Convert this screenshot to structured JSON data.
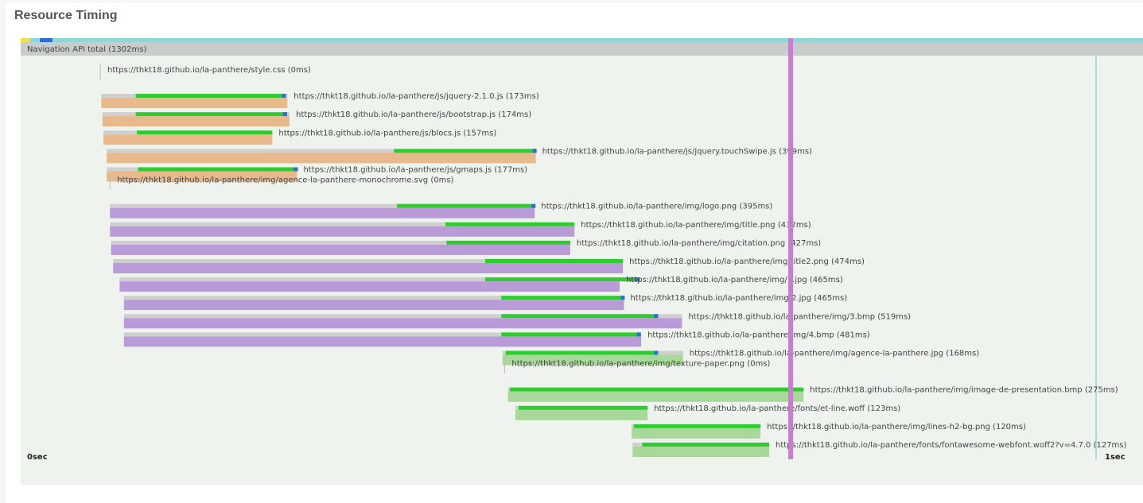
{
  "page": {
    "title": "Resource Timing"
  },
  "chart_data": {
    "type": "bar",
    "title": "Resource Timing",
    "time_unit": "ms",
    "xlim": [
      0,
      1000
    ],
    "x_ticks": [
      "0sec",
      "1sec"
    ],
    "navigation_total": {
      "label": "Navigation API total (1302ms)",
      "duration_ms": 1302
    },
    "colors": {
      "css": "#e8b98a",
      "js": "#e8b98a",
      "img": "#b99bd8",
      "other": "#a8d89a",
      "response": "#2ecc2e",
      "dns_connect": "#2a6fd6",
      "wait": "#cfcfcf",
      "marker": "#cc7ad6",
      "axis_line": "#8fd6d6",
      "lane": "#eef3ee"
    },
    "marker_ms": 716,
    "resources": [
      {
        "url": "https://thkt18.github.io/la-panthere/style.css (0ms)",
        "kind": "css",
        "start": 74,
        "duration": 0,
        "resp_start": 74,
        "resp_end": 74,
        "blue": false
      },
      {
        "url": "https://thkt18.github.io/la-panthere/js/jquery-2.1.0.js (173ms)",
        "kind": "js",
        "start": 75,
        "duration": 173,
        "resp_start": 107,
        "resp_end": 246,
        "blue": true
      },
      {
        "url": "https://thkt18.github.io/la-panthere/js/bootstrap.js (174ms)",
        "kind": "js",
        "start": 76,
        "duration": 174,
        "resp_start": 107,
        "resp_end": 247,
        "blue": true
      },
      {
        "url": "https://thkt18.github.io/la-panthere/js/blocs.js (157ms)",
        "kind": "js",
        "start": 77,
        "duration": 157,
        "resp_start": 108,
        "resp_end": 234,
        "blue": false
      },
      {
        "url": "https://thkt18.github.io/la-panthere/js/jquery.touchSwipe.js (399ms)",
        "kind": "js",
        "start": 80,
        "duration": 399,
        "resp_start": 347,
        "resp_end": 479,
        "blue": true
      },
      {
        "url": "https://thkt18.github.io/la-panthere/js/gmaps.js (177ms)",
        "kind": "js",
        "start": 80,
        "duration": 177,
        "resp_start": 109,
        "resp_end": 257,
        "blue": true
      },
      {
        "url": "https://thkt18.github.io/la-panthere/img/agence-la-panthere-monochrome.svg (0ms)",
        "kind": "img",
        "start": 83,
        "duration": 0,
        "resp_start": 83,
        "resp_end": 83,
        "blue": false
      },
      {
        "url": "https://thkt18.github.io/la-panthere/img/logo.png (395ms)",
        "kind": "img",
        "start": 83,
        "duration": 395,
        "resp_start": 350,
        "resp_end": 478,
        "blue": true
      },
      {
        "url": "https://thkt18.github.io/la-panthere/img/title.png (432ms)",
        "kind": "img",
        "start": 83,
        "duration": 432,
        "resp_start": 395,
        "resp_end": 515,
        "blue": false
      },
      {
        "url": "https://thkt18.github.io/la-panthere/img/citation.png (427ms)",
        "kind": "img",
        "start": 84,
        "duration": 427,
        "resp_start": 396,
        "resp_end": 511,
        "blue": false
      },
      {
        "url": "https://thkt18.github.io/la-panthere/img/title2.png (474ms)",
        "kind": "img",
        "start": 86,
        "duration": 474,
        "resp_start": 432,
        "resp_end": 560,
        "blue": false
      },
      {
        "url": "https://thkt18.github.io/la-panthere/img/1.jpg (465ms)",
        "kind": "img",
        "start": 92,
        "duration": 465,
        "resp_start": 432,
        "resp_end": 575,
        "blue": true
      },
      {
        "url": "https://thkt18.github.io/la-panthere/img/2.jpg (465ms)",
        "kind": "img",
        "start": 96,
        "duration": 465,
        "resp_start": 447,
        "resp_end": 561,
        "blue": true
      },
      {
        "url": "https://thkt18.github.io/la-panthere/img/3.bmp (519ms)",
        "kind": "img",
        "start": 96,
        "duration": 519,
        "resp_start": 447,
        "resp_end": 592,
        "blue": true
      },
      {
        "url": "https://thkt18.github.io/la-panthere/img/4.bmp (481ms)",
        "kind": "img",
        "start": 96,
        "duration": 481,
        "resp_start": 447,
        "resp_end": 576,
        "blue": true
      },
      {
        "url": "https://thkt18.github.io/la-panthere/img/agence-la-panthere.jpg (168ms)",
        "kind": "other",
        "start": 448,
        "duration": 168,
        "resp_start": 451,
        "resp_end": 592,
        "blue": true
      },
      {
        "url": "https://thkt18.github.io/la-panthere/img/texture-paper.png (0ms)",
        "kind": "other",
        "start": 450,
        "duration": 0,
        "resp_start": 450,
        "resp_end": 450,
        "blue": false
      },
      {
        "url": "https://thkt18.github.io/la-panthere/img/image-de-presentation.bmp (275ms)",
        "kind": "other",
        "start": 453,
        "duration": 275,
        "resp_start": 455,
        "resp_end": 728,
        "blue": false
      },
      {
        "url": "https://thkt18.github.io/la-panthere/fonts/et-line.woff (123ms)",
        "kind": "other",
        "start": 460,
        "duration": 123,
        "resp_start": 463,
        "resp_end": 583,
        "blue": false
      },
      {
        "url": "https://thkt18.github.io/la-panthere/img/lines-h2-bg.png (120ms)",
        "kind": "other",
        "start": 568,
        "duration": 120,
        "resp_start": 570,
        "resp_end": 688,
        "blue": false
      },
      {
        "url": "https://thkt18.github.io/la-panthere/fonts/fontawesome-webfont.woff2?v=4.7.0 (127ms)",
        "kind": "other",
        "start": 569,
        "duration": 127,
        "resp_start": 578,
        "resp_end": 696,
        "blue": false
      }
    ]
  }
}
